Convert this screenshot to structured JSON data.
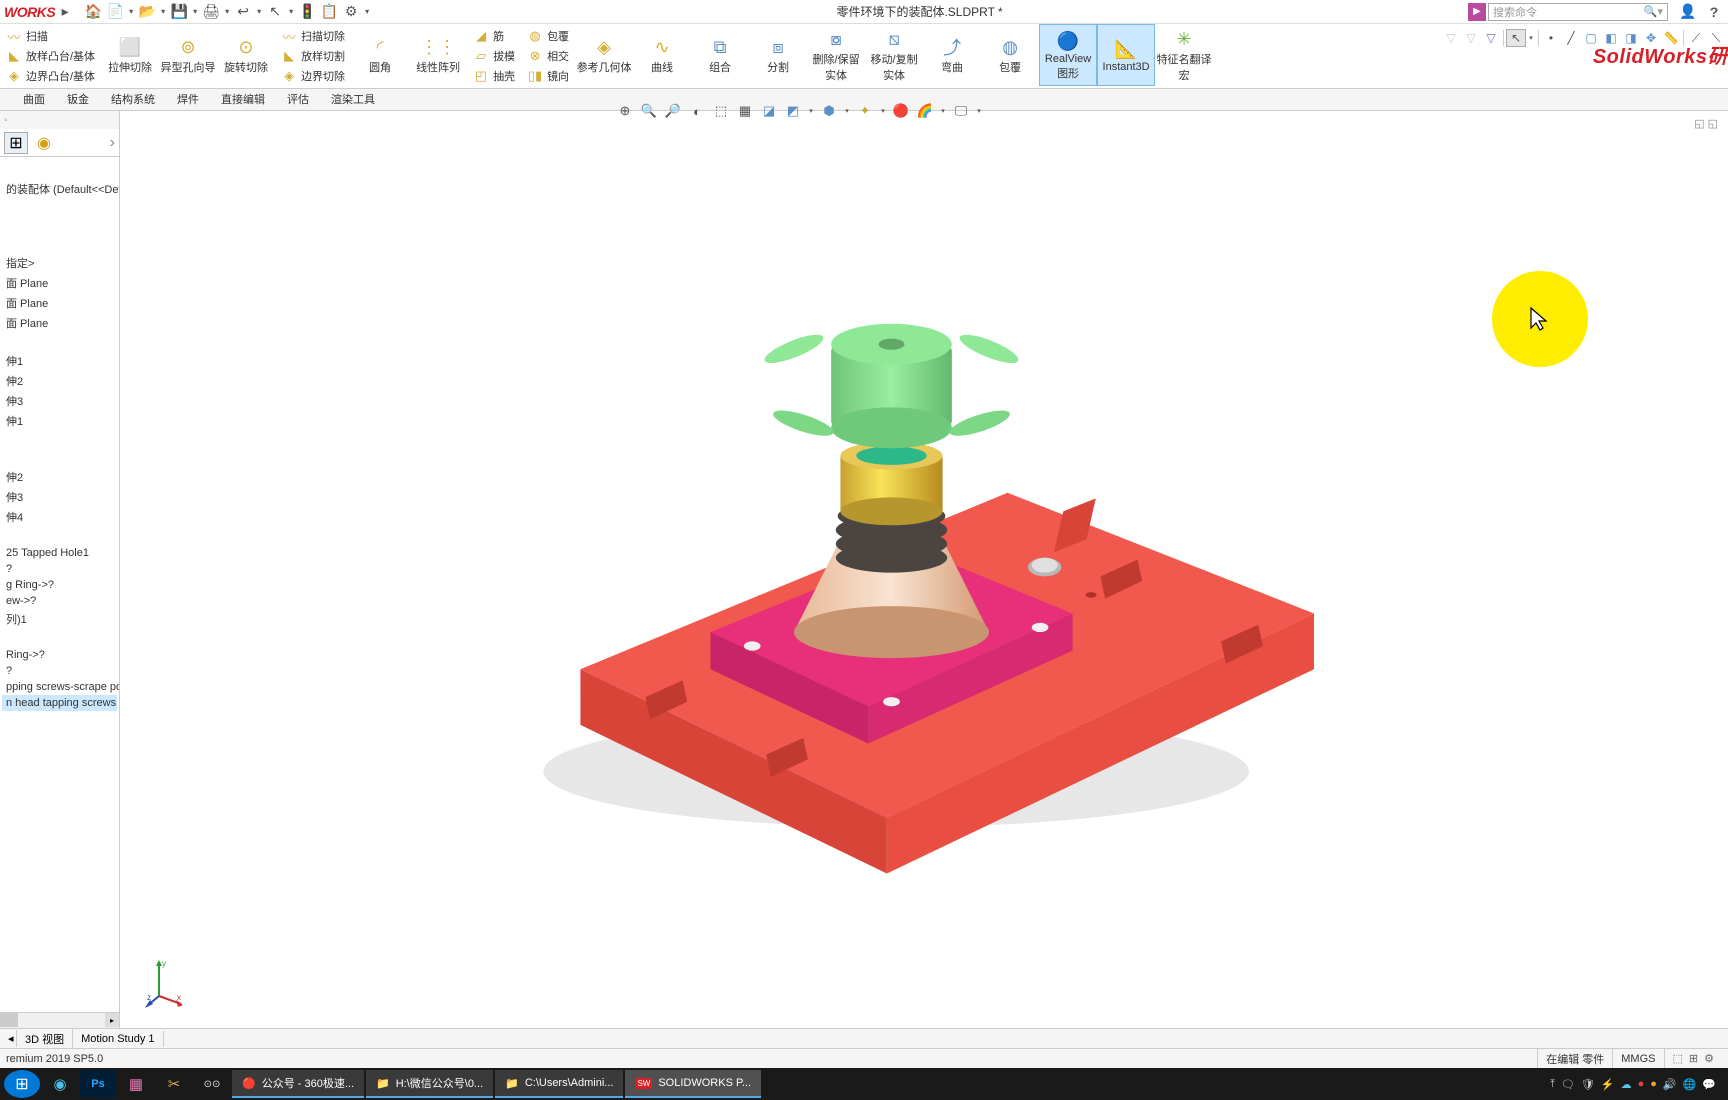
{
  "logo": "WORKS",
  "doc_title": "零件环境下的装配体.SLDPRT *",
  "search": {
    "placeholder": "搜索命令"
  },
  "watermark": "SolidWorks研",
  "ribbon": {
    "sweep": "扫描",
    "loft": "放样凸台/基体",
    "boundary": "边界凸台/基体",
    "extrude_cut": "拉伸切除",
    "hole": "异型孔向导",
    "revolve_cut": "旋转切除",
    "sweep_cut": "扫描切除",
    "loft_cut": "放样切割",
    "boundary_cut": "边界切除",
    "fillet": "圆角",
    "pattern": "线性阵列",
    "rib": "筋",
    "draft": "拔模",
    "shell": "抽壳",
    "wrap": "包覆",
    "intersect": "相交",
    "mirror": "镜向",
    "refgeo": "参考几何体",
    "curves": "曲线",
    "combine": "组合",
    "split": "分割",
    "deletekeep": "删除/保留实体",
    "movecopy": "移动/复制实体",
    "bend": "弯曲",
    "enclose": "包覆",
    "realview": "RealView 图形",
    "instant3d": "Instant3D",
    "rename": "特征名翻译宏"
  },
  "tabs": {
    "t1": "曲面",
    "t2": "钣金",
    "t3": "结构系统",
    "t4": "焊件",
    "t5": "直接编辑",
    "t6": "评估",
    "t7": "渲染工具"
  },
  "tree": {
    "root": "的装配体 (Default<<Defau",
    "notset": "指定>",
    "p1": "面 Plane",
    "p2": "面 Plane",
    "p3": "面 Plane",
    "b1": "伸1",
    "b2": "伸2",
    "b3": "伸3",
    "b4": "伸1",
    "b5": "伸2",
    "b6": "伸3",
    "b7": "伸4",
    "h1": "25 Tapped Hole1",
    "q1": "?",
    "r1": "g Ring->?",
    "e1": "ew->?",
    "a1": "列)1",
    "r2": "Ring->?",
    "q2": "?",
    "s1": "pping screws-scrape poin",
    "s2": "n head tapping screws wi"
  },
  "bottom_tabs": {
    "t1": "3D 视图",
    "t2": "Motion Study 1"
  },
  "status": {
    "version": "remium 2019 SP5.0",
    "editing": "在编辑 零件",
    "units": "MMGS"
  },
  "taskbar": {
    "t1": "公众号 - 360极速...",
    "t2": "H:\\微信公众号\\0...",
    "t3": "C:\\Users\\Admini...",
    "t4": "SOLIDWORKS P..."
  }
}
